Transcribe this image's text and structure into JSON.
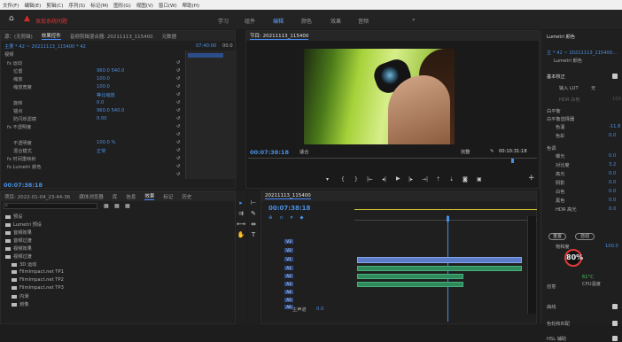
{
  "menu": [
    "文件(F)",
    "编辑(E)",
    "剪辑(C)",
    "序列(S)",
    "标记(M)",
    "图形(G)",
    "视图(V)",
    "窗口(W)",
    "帮助(H)"
  ],
  "workspace": {
    "warning": "发现系统问题",
    "tabs": [
      "学习",
      "组件",
      "编辑",
      "颜色",
      "效果",
      "音频"
    ],
    "active": "编辑",
    "more": "»"
  },
  "effects_panel": {
    "tabs": [
      "源：(无剪辑)",
      "效果控件",
      "音频剪辑混合器: 20211113_115400",
      "元数据"
    ],
    "active": "效果控件",
    "master": "主要 * 42 ~ 20211113_115400 * 42",
    "seq_time": "07:40:00",
    "seq_end": "00:0",
    "video_label": "视频",
    "rows": [
      {
        "name": "fx 运动",
        "indent": 1,
        "value": ""
      },
      {
        "name": "位置",
        "indent": 2,
        "value": "960.0   540.0"
      },
      {
        "name": "缩放",
        "indent": 2,
        "value": "100.0"
      },
      {
        "name": "缩放宽度",
        "indent": 2,
        "value": "100.0"
      },
      {
        "name": "",
        "indent": 2,
        "value": "等比缩放"
      },
      {
        "name": "旋转",
        "indent": 2,
        "value": "0.0"
      },
      {
        "name": "锚点",
        "indent": 2,
        "value": "960.0   540.0"
      },
      {
        "name": "防闪烁滤镜",
        "indent": 2,
        "value": "0.00"
      },
      {
        "name": "fx 不透明度",
        "indent": 1,
        "value": ""
      },
      {
        "name": "",
        "indent": 2,
        "value": ""
      },
      {
        "name": "不透明度",
        "indent": 2,
        "value": "100.0 %"
      },
      {
        "name": "混合模式",
        "indent": 2,
        "value": "正常"
      },
      {
        "name": "fx 时间重映射",
        "indent": 1,
        "value": ""
      },
      {
        "name": "fx Lumetri 颜色",
        "indent": 1,
        "value": ""
      },
      {
        "name": "",
        "indent": 2,
        "value": ""
      }
    ],
    "timecode": "00:07:38:18"
  },
  "program": {
    "title": "节目: 20211113_115400",
    "timecode": "00:07:38:18",
    "fit": "适合",
    "quality": "完整",
    "duration": "00:10:31:18"
  },
  "project": {
    "tabs": [
      "项目: 2022-01-04_23-44-36",
      "媒体浏览器",
      "库",
      "信息",
      "效果",
      "标记",
      "历史"
    ],
    "active": "效果",
    "items": [
      "预设",
      "Lumetri 预设",
      "音频效果",
      "音频过渡",
      "视频效果",
      "视频过渡",
      "3D 运动",
      "FilmImpact.net TP1",
      "FilmImpact.net TP2",
      "FilmImpact.net TP3",
      "内滑",
      "划像"
    ]
  },
  "timeline": {
    "title": "20211113_115400",
    "timecode": "00:07:38:18",
    "tracks": [
      {
        "name": "V3",
        "kind": "v"
      },
      {
        "name": "V2",
        "kind": "v"
      },
      {
        "name": "V1",
        "kind": "v"
      },
      {
        "name": "A1",
        "kind": "a"
      },
      {
        "name": "A2",
        "kind": "a"
      },
      {
        "name": "A3",
        "kind": "a"
      },
      {
        "name": "A4",
        "kind": "a"
      },
      {
        "name": "A5",
        "kind": "a"
      },
      {
        "name": "A6",
        "kind": "a"
      }
    ],
    "master": "主声道",
    "master_value": "0.0"
  },
  "lumetri": {
    "title": "Lumetri 颜色",
    "master": "主 * 42 ~ 20211113_115400...",
    "preset": "Lumetri 颜色",
    "section": "基本校正",
    "input_lut": "输入 LUT",
    "input_lut_value": "无",
    "hdr": "HDR 白色",
    "hdr_value": "100",
    "wb": "白平衡",
    "wb_picker": "白平衡选择器",
    "temp": "色温",
    "temp_value": "-11.8",
    "tint": "色彩",
    "tint_value": "0.0",
    "tone": "色调",
    "rows": [
      {
        "label": "曝光",
        "value": "0.0"
      },
      {
        "label": "对比度",
        "value": "3.2"
      },
      {
        "label": "高光",
        "value": "0.0"
      },
      {
        "label": "阴影",
        "value": "0.0"
      },
      {
        "label": "白色",
        "value": "0.0"
      },
      {
        "label": "黑色",
        "value": "0.0"
      },
      {
        "label": "HDR 高光",
        "value": "0.0"
      }
    ],
    "reset": "重置",
    "auto": "自动",
    "saturation": "饱和度",
    "saturation_value": "100.0",
    "cpu_pct": "80%",
    "cpu_temp": "61°C",
    "cpu_label": "CPU温度",
    "sub": "创意",
    "curves": "曲线",
    "wheels": "色轮和匹配",
    "hsl": "HSL 辅助"
  }
}
